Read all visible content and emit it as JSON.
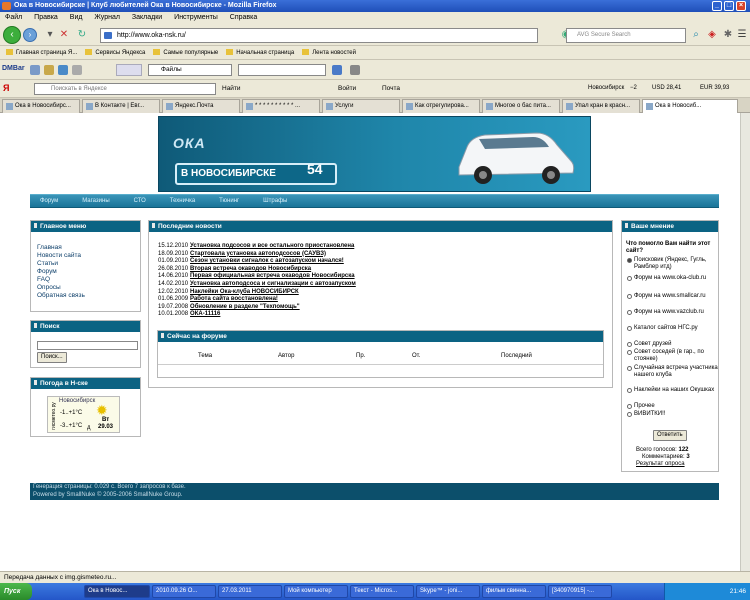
{
  "window": {
    "title": "Ока в Новосибирске | Клуб любителей Ока в Новосибирске - Mozilla Firefox"
  },
  "menubar": [
    "Файл",
    "Правка",
    "Вид",
    "Журнал",
    "Закладки",
    "Инструменты",
    "Справка"
  ],
  "nav": {
    "url": "http://www.oka-nsk.ru/",
    "search_placeholder": "AVG Secure Search"
  },
  "bookmarks": [
    "Главная страница Я...",
    "Сервисы Яндекса",
    "Самые популярные",
    "Начальная страница",
    "Лента новостей"
  ],
  "dmbar": {
    "logo": "DMBar",
    "files_label": "Файлы"
  },
  "yabar": {
    "search_placeholder": "Поискать в Яндексе",
    "find_label": "Найти",
    "login_label": "Войти",
    "mail_label": "Почта",
    "city": "Новосибирск",
    "temp": "−2",
    "usd": "USD 28,41",
    "eur": "EUR 39,93"
  },
  "tabs": [
    {
      "label": "Ока в Новосибирс..."
    },
    {
      "label": "В Контакте | Евг..."
    },
    {
      "label": "Яндекс.Почта"
    },
    {
      "label": "* * * * * * * * * * ..."
    },
    {
      "label": "Услуги"
    },
    {
      "label": "Как отрегулирова..."
    },
    {
      "label": "Многое о бас пита..."
    },
    {
      "label": "Упал кран в красн..."
    },
    {
      "label": "Ока в Новосиб..."
    }
  ],
  "site": {
    "logo_oka": "ОКА",
    "logo_city": "В НОВОСИБИРСКЕ",
    "logo_num": "54",
    "nav": [
      "Форум",
      "Магазины",
      "СТО",
      "Техничка",
      "Тюнинг",
      "Штрафы"
    ]
  },
  "left": {
    "main_menu_title": "Главное меню",
    "main_menu": [
      "Главная",
      "Новости сайта",
      "Статьи",
      "Форум",
      "FAQ",
      "Опросы",
      "Обратная связь"
    ],
    "search_title": "Поиск",
    "search_button": "Поиск...",
    "weather_title": "Погода в Н-ске",
    "weather": {
      "city": "Новосибирск",
      "temp1": "-1..+1°C",
      "temp2": "-3..+1°C",
      "side": "гисметео.ру",
      "day_label": "Вт",
      "date": "29.03",
      "d_label": "д"
    }
  },
  "center": {
    "news_title": "Последние новости",
    "news": [
      {
        "date": "15.12.2010",
        "title": "Установка подсосов и все остального приостановлена"
      },
      {
        "date": "18.09.2010",
        "title": "Стартовала установка автоподсосов (САУВЗ)"
      },
      {
        "date": "01.09.2010",
        "title": "Сезон установки сигналок с автозапуском начался!"
      },
      {
        "date": "26.08.2010",
        "title": "Вторая встреча окаводов Новосибирска"
      },
      {
        "date": "14.06.2010",
        "title": "Первая официальная встреча окаводов Новосибирска"
      },
      {
        "date": "14.02.2010",
        "title": "Установка автоподсоса и сигнализации с автозапуском"
      },
      {
        "date": "12.02.2010",
        "title": "Наклейки Ока-клуба НОВОСИБИРСК"
      },
      {
        "date": "01.06.2009",
        "title": "Работа сайта восстановлена!"
      },
      {
        "date": "19.07.2008",
        "title": "Обновление в разделе \"Техпомощь\""
      },
      {
        "date": "10.01.2008",
        "title": "ОКА-11116"
      }
    ],
    "forum_title": "Сейчас на форуме",
    "forum_cols": [
      "Тема",
      "Автор",
      "Пр.",
      "От.",
      "Последний"
    ]
  },
  "right": {
    "title": "Ваше мнение",
    "question": "Что помогло Вам найти этот сайт?",
    "options": [
      {
        "label": "Поисковик (Яндекс, Гугль, Рамблер итд)",
        "checked": true
      },
      {
        "label": "Форум на www.oka-club.ru",
        "checked": false
      },
      {
        "label": "Форум на www.smallcar.ru",
        "checked": false
      },
      {
        "label": "Форум на www.vazclub.ru",
        "checked": false
      },
      {
        "label": "Каталог сайтов НГС.ру",
        "checked": false
      },
      {
        "label": "Совет друзей",
        "checked": false
      },
      {
        "label": "Совет соседей (в гар., по стоянке)",
        "checked": false
      },
      {
        "label": "Случайная встреча участника нашего клуба",
        "checked": false
      },
      {
        "label": "Наклейки на наших Окушках",
        "checked": false
      },
      {
        "label": "Прочее",
        "checked": false
      },
      {
        "label": "ВИВИТКИ!!",
        "checked": false
      }
    ],
    "vote_button": "Ответить",
    "total_label": "Всего голосов:",
    "total": "122",
    "comments_label": "Комментариев:",
    "comments": "3",
    "results_link": "Результат опроса"
  },
  "footer": {
    "line1": "Генерация страницы: 0.029 с. Всего 7 запросов к базе.",
    "line2": "Powered by SmallNuke © 2005-2006 SmallNuke Group."
  },
  "status": "Передача данных с img.gismeteo.ru...",
  "taskbar": {
    "start": "Пуск",
    "tasks": [
      "Ока в Новос...",
      "2010.09.26 О...",
      "27.03.2011",
      "Мой компьютер",
      "Текст - Micros...",
      "Skype™ - joni...",
      "фильм свинна...",
      "[340970915] -..."
    ],
    "clock": "21:46"
  }
}
